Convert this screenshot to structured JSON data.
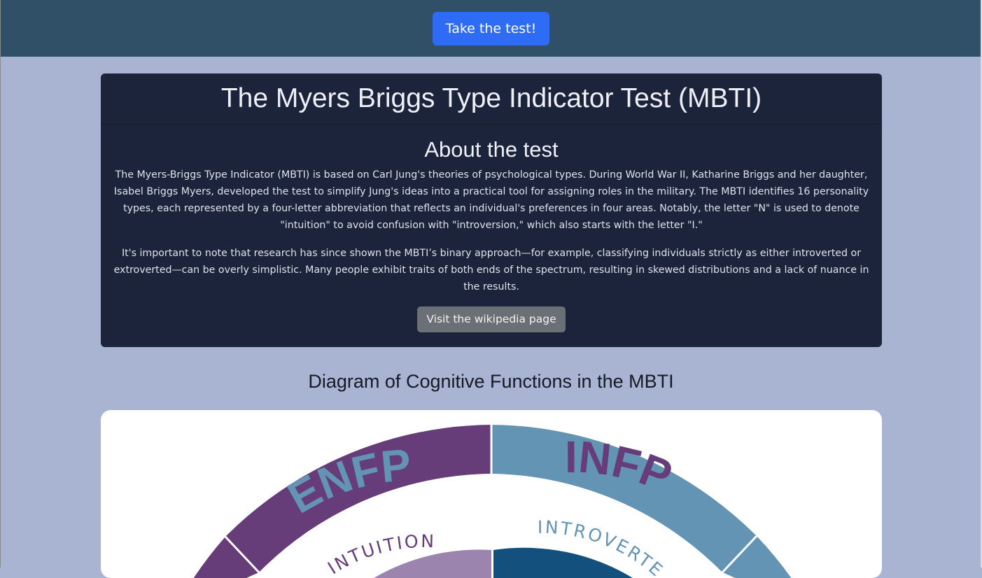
{
  "header": {
    "cta_label": "Take the test!"
  },
  "card": {
    "title": "The Myers Briggs Type Indicator Test (MBTI)",
    "about_title": "About the test",
    "paragraph_1": "The Myers-Briggs Type Indicator (MBTI) is based on Carl Jung's theories of psychological types. During World War II, Katharine Briggs and her daughter, Isabel Briggs Myers, developed the test to simplify Jung's ideas into a practical tool for assigning roles in the military. The MBTI identifies 16 personality types, each represented by a four-letter abbreviation that reflects an individual's preferences in four areas. Notably, the letter \"N\" is used to denote \"intuition\" to avoid confusion with \"introversion,\" which also starts with the letter \"I.\"",
    "paragraph_2": "It's important to note that research has since shown the MBTI’s binary approach—for example, classifying individuals strictly as either introverted or extroverted—can be overly simplistic. Many people exhibit traits of both ends of the spectrum, resulting in skewed distributions and a lack of nuance in the results.",
    "wiki_button_label": "Visit the wikipedia page"
  },
  "diagram": {
    "heading": "Diagram of Cognitive Functions in the MBTI",
    "segments": {
      "enfp": "ENFP",
      "infp": "INFP",
      "intuition": "INTUITION",
      "introverted": "INTROVERTED"
    },
    "colors": {
      "purple": "#663c79",
      "steel_blue": "#6494b3",
      "navy": "#14507e",
      "lavender": "#9b84ad",
      "ring_white": "#ffffff"
    }
  }
}
